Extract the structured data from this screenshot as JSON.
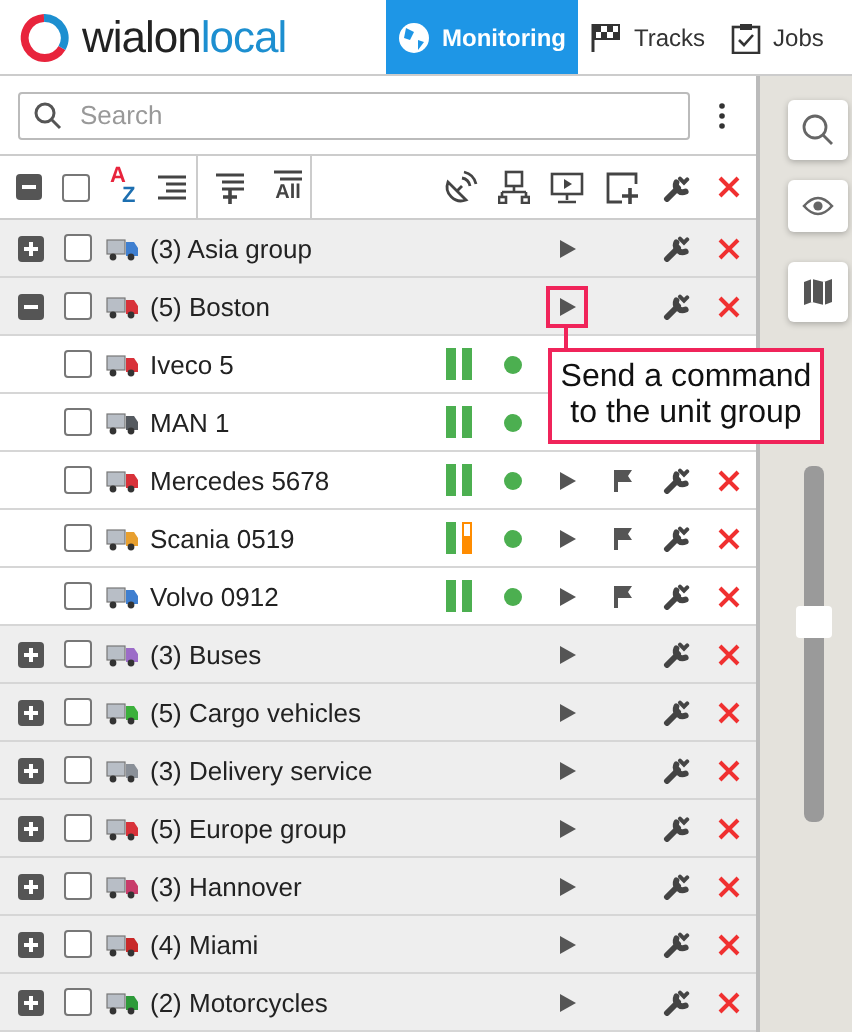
{
  "logo": {
    "text": "wialon",
    "suffix": "local"
  },
  "tabs": [
    {
      "label": "Monitoring",
      "selected": true,
      "kind": "globe"
    },
    {
      "label": "Tracks",
      "selected": false,
      "kind": "flag"
    },
    {
      "label": "Jobs",
      "selected": false,
      "kind": "clipboard"
    }
  ],
  "search": {
    "placeholder": "Search"
  },
  "toolbar": {
    "select_all_checked": false,
    "sort_letters": [
      "A",
      "Z"
    ],
    "show_all_label": "All"
  },
  "groups": [
    {
      "name": "(3) Asia group",
      "color": "#3f7fd0",
      "expanded": false,
      "checked": false
    },
    {
      "name": "(5) Boston",
      "color": "#d8323a",
      "expanded": true,
      "checked": false,
      "callout": {
        "text": "Send a command to the unit group"
      },
      "children": [
        {
          "name": "Iveco 5",
          "color": "#d8323a",
          "checked": false,
          "online": true,
          "connection_bars": [
            {
              "color": "#4caf50",
              "level": 1
            },
            {
              "color": "#4caf50",
              "level": 1
            }
          ]
        },
        {
          "name": "MAN 1",
          "color": "#555a60",
          "checked": false,
          "online": true,
          "connection_bars": [
            {
              "color": "#4caf50",
              "level": 1
            },
            {
              "color": "#4caf50",
              "level": 1
            }
          ]
        },
        {
          "name": "Mercedes 5678",
          "color": "#d8323a",
          "checked": false,
          "online": true,
          "connection_bars": [
            {
              "color": "#4caf50",
              "level": 1
            },
            {
              "color": "#4caf50",
              "level": 1
            }
          ]
        },
        {
          "name": "Scania 0519",
          "color": "#e8a030",
          "checked": false,
          "online": true,
          "connection_bars": [
            {
              "color": "#4caf50",
              "level": 1
            },
            {
              "color": "#ff8c00",
              "level": 0.6
            }
          ]
        },
        {
          "name": "Volvo 0912",
          "color": "#3f7fd0",
          "checked": false,
          "online": true,
          "connection_bars": [
            {
              "color": "#4caf50",
              "level": 1
            },
            {
              "color": "#4caf50",
              "level": 1
            }
          ]
        }
      ]
    },
    {
      "name": "(3) Buses",
      "color": "#9c6cc8",
      "expanded": false,
      "checked": false
    },
    {
      "name": "(5) Cargo vehicles",
      "color": "#3cb03c",
      "expanded": false,
      "checked": false
    },
    {
      "name": "(3) Delivery service",
      "color": "#8a9098",
      "expanded": false,
      "checked": false
    },
    {
      "name": "(5) Europe group",
      "color": "#d8323a",
      "expanded": false,
      "checked": false
    },
    {
      "name": "(3) Hannover",
      "color": "#c83c6a",
      "expanded": false,
      "checked": false
    },
    {
      "name": "(4) Miami",
      "color": "#c82828",
      "expanded": false,
      "checked": false
    },
    {
      "name": "(2) Motorcycles",
      "color": "#2e9a3a",
      "expanded": false,
      "checked": false
    }
  ],
  "map": {
    "zoom": {
      "level": 0.56
    }
  }
}
